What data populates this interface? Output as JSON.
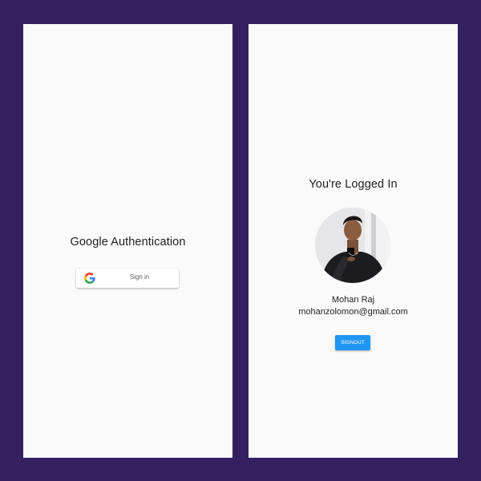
{
  "colors": {
    "background": "#35205f",
    "screen": "#fafafa",
    "signout_button": "#2196f3"
  },
  "left_screen": {
    "title": "Google Authentication",
    "sign_in_button": {
      "icon": "google-g-icon",
      "label": "Sign in"
    }
  },
  "right_screen": {
    "title": "You're Logged In",
    "avatar": "profile-photo",
    "user": {
      "name": "Mohan Raj",
      "email": "mohanzolomon@gmail.com"
    },
    "signout_label": "SIGNOUT"
  }
}
